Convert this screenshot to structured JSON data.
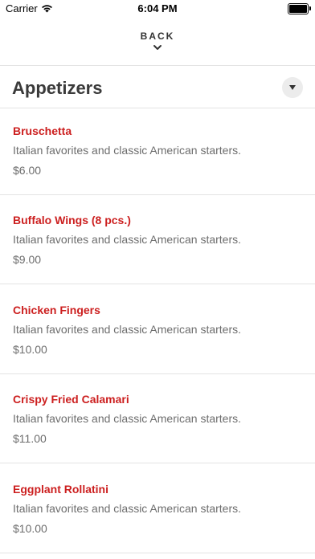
{
  "status_bar": {
    "carrier": "Carrier",
    "time": "6:04 PM",
    "battery_level": 1.0
  },
  "navigation": {
    "back_label": "BACK"
  },
  "section": {
    "title": "Appetizers"
  },
  "items": [
    {
      "name": "Bruschetta",
      "description": "Italian favorites and classic American starters.",
      "price": "$6.00"
    },
    {
      "name": "Buffalo Wings (8 pcs.)",
      "description": "Italian favorites and classic American starters.",
      "price": "$9.00"
    },
    {
      "name": "Chicken Fingers",
      "description": "Italian favorites and classic American starters.",
      "price": "$10.00"
    },
    {
      "name": "Crispy Fried Calamari",
      "description": "Italian favorites and classic American starters.",
      "price": "$11.00"
    },
    {
      "name": "Eggplant Rollatini",
      "description": "Italian favorites and classic American starters.",
      "price": "$10.00"
    }
  ],
  "colors": {
    "item_name": "#cc1f1f",
    "text_secondary": "#6d6d6d",
    "divider": "#e3e3e3"
  }
}
